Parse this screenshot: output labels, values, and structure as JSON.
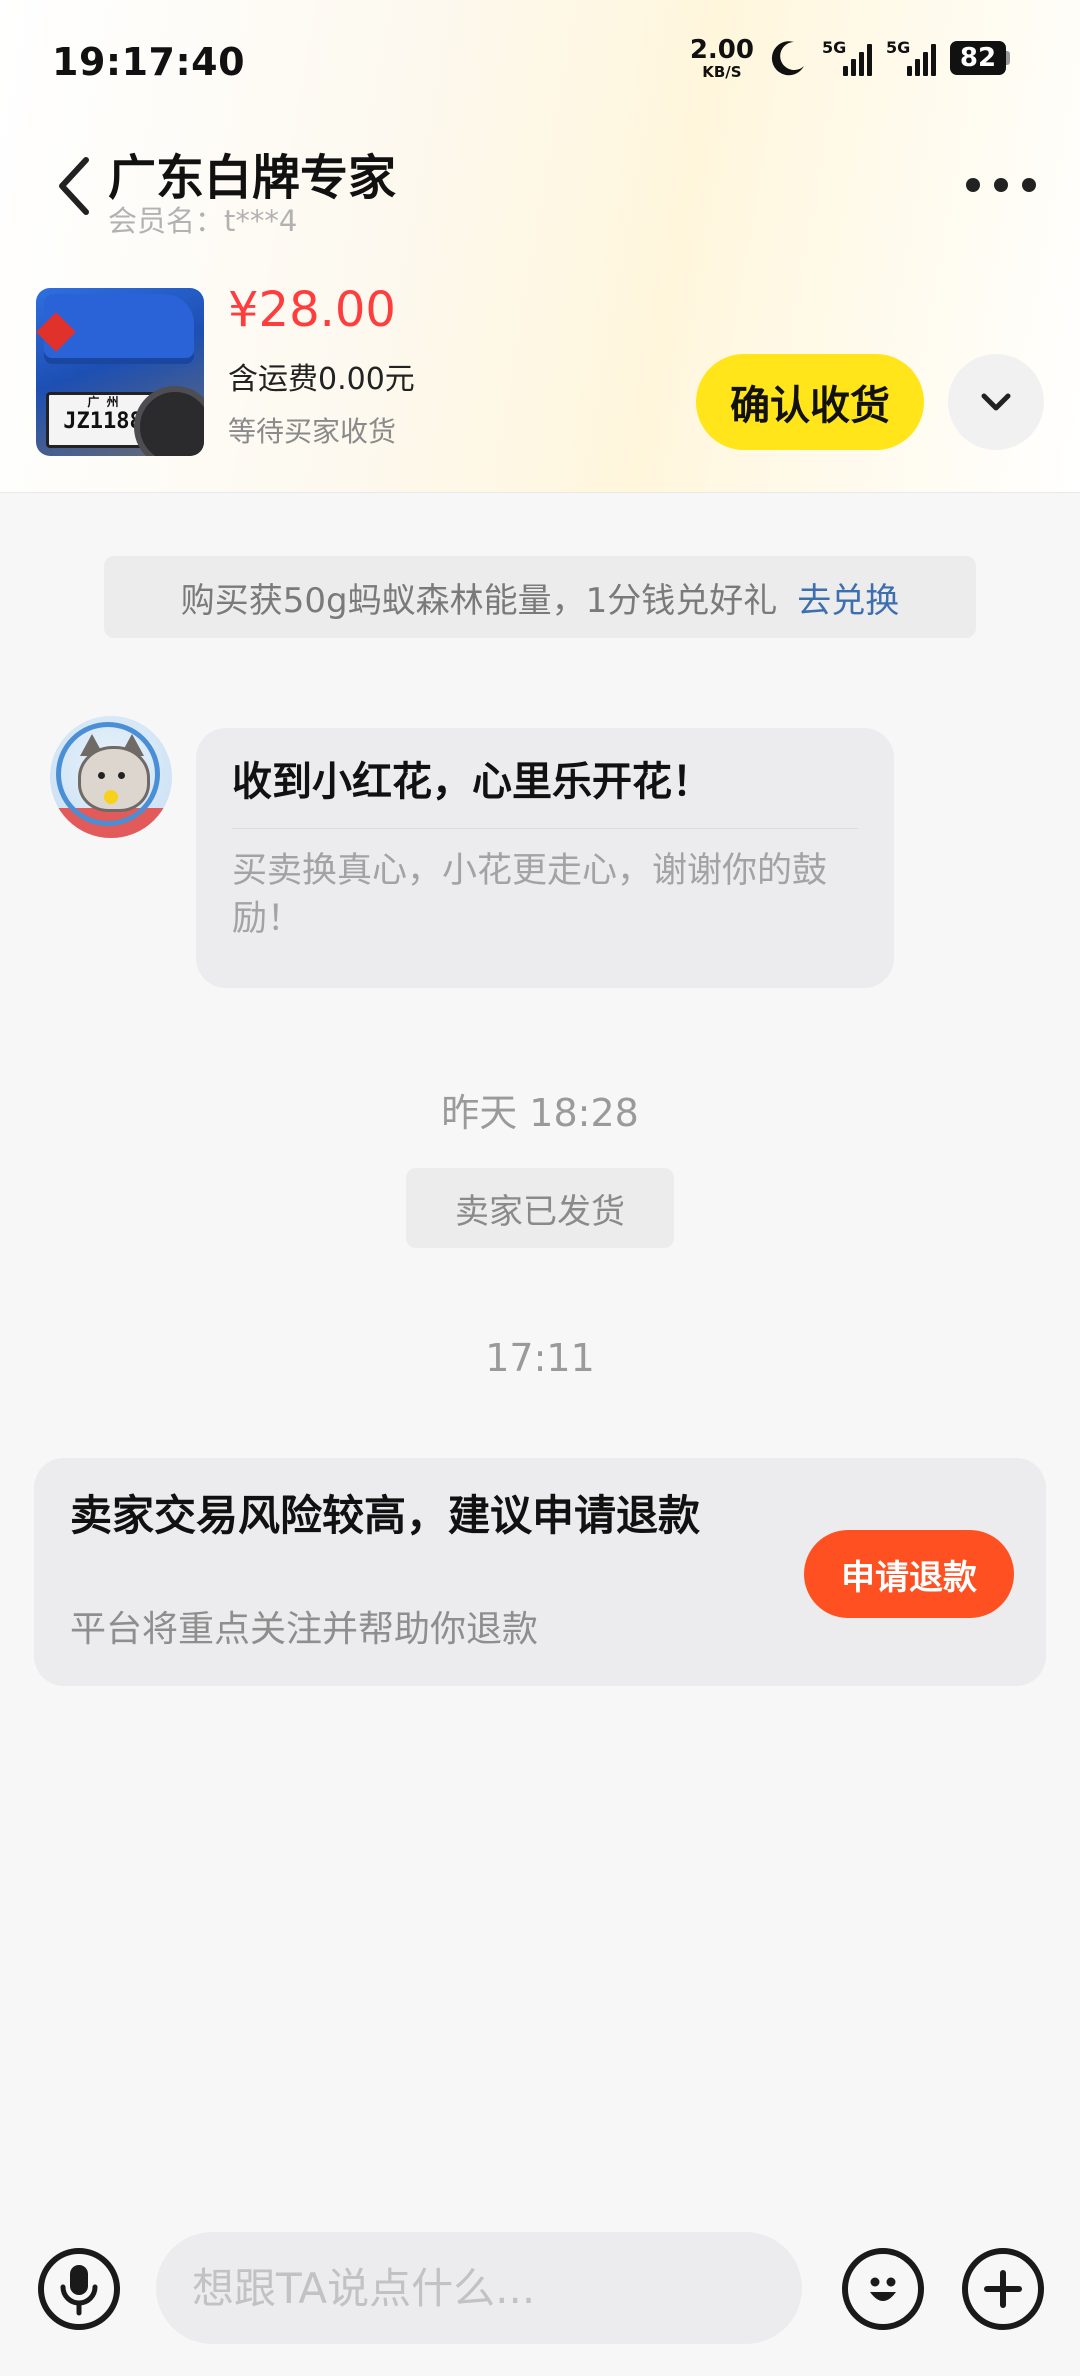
{
  "status_bar": {
    "time": "19:17:40",
    "net_speed_value": "2.00",
    "net_speed_unit": "KB/S",
    "sim1_label": "5G",
    "sim2_label": "5G",
    "battery": "82"
  },
  "header": {
    "shop_name": "广东白牌专家",
    "member_label": "会员名：t***4"
  },
  "product": {
    "price": "¥28.00",
    "shipping": "含运费0.00元",
    "status": "等待买家收货",
    "confirm_label": "确认收货",
    "plate_city": "广 州",
    "plate_no": "JZ1188"
  },
  "promo": {
    "text": "购买获50g蚂蚁森林能量，1分钱兑好礼",
    "link": "去兑换"
  },
  "flower_card": {
    "title": "收到小红花，心里乐开花！",
    "body": "买卖换真心，小花更走心，谢谢你的鼓励！"
  },
  "timeline": {
    "timestamp_1": "昨天 18:28",
    "system_message": "卖家已发货",
    "timestamp_2": "17:11"
  },
  "risk_card": {
    "title": "卖家交易风险较高，建议申请退款",
    "desc": "平台将重点关注并帮助你退款",
    "button": "申请退款"
  },
  "composer": {
    "placeholder": "想跟TA说点什么..."
  },
  "colors": {
    "price_red": "#ff3d3d",
    "confirm_yellow": "#ffe51a",
    "refund_orange": "#ff5022",
    "link_blue": "#3d6fb0"
  },
  "icons": {
    "back": "chevron-left-icon",
    "more": "more-dots-icon",
    "expand": "chevron-down-icon",
    "mic": "microphone-icon",
    "emoji": "smiley-icon",
    "plus": "plus-icon"
  }
}
